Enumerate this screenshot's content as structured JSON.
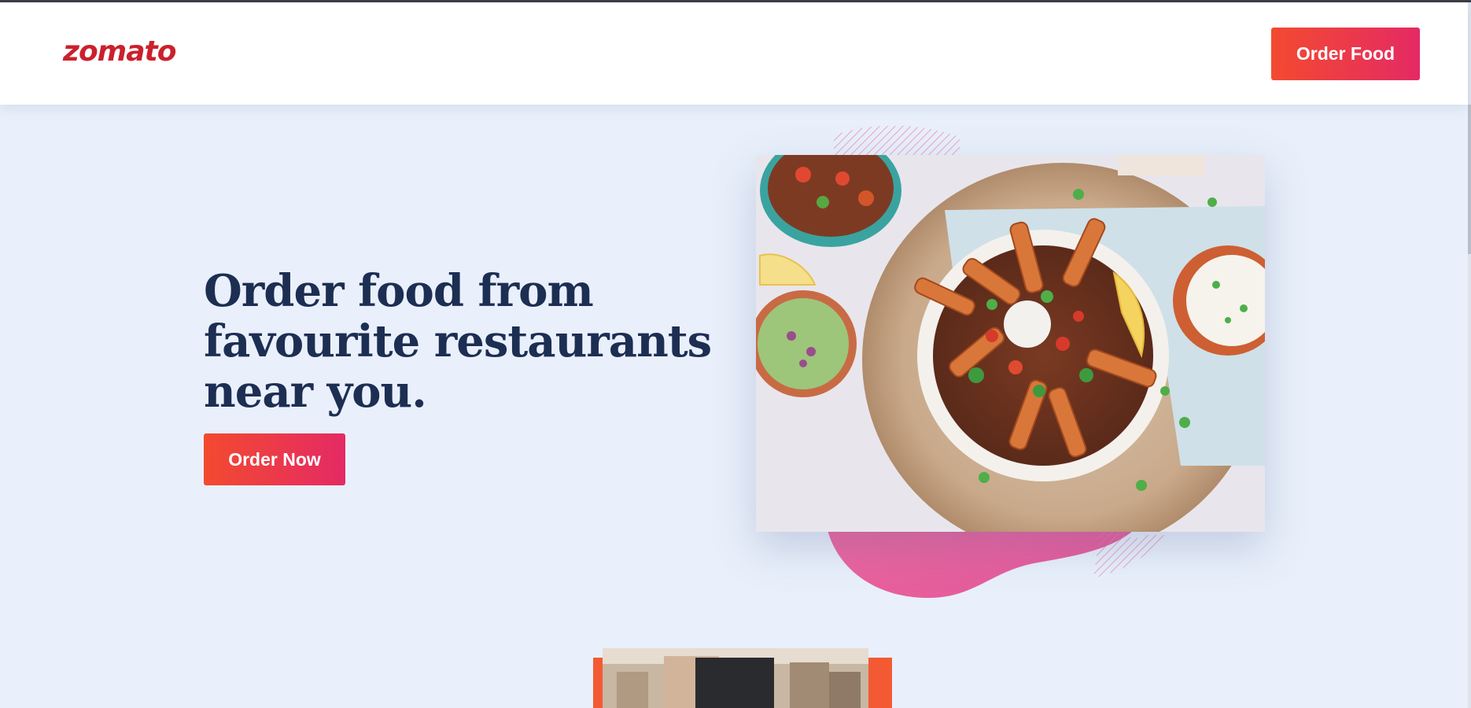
{
  "brand": {
    "logo_text": "zomato",
    "logo_color": "#cb202d"
  },
  "navbar": {
    "order_food_label": "Order Food"
  },
  "hero": {
    "headline": "Order food from favourite restaurants near you.",
    "cta_label": "Order Now",
    "image_alt": "food-bowl-photo"
  },
  "colors": {
    "page_background": "#e9f0fb",
    "headline": "#1d2e53",
    "button_gradient_start": "#f34a30",
    "button_gradient_end": "#e42a64",
    "blob_pink": "#e85fa0"
  }
}
